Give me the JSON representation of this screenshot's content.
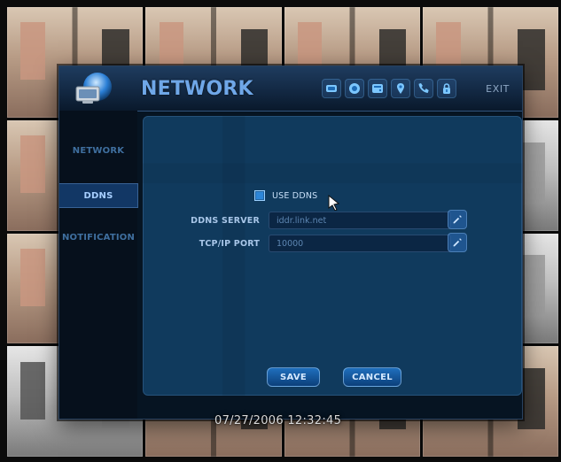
{
  "window": {
    "title": "NETWORK",
    "exit_label": "EXIT"
  },
  "sidebar": {
    "items": [
      {
        "label": "NETWORK",
        "active": false
      },
      {
        "label": "DDNS",
        "active": true
      },
      {
        "label": "NOTIFICATION",
        "active": false
      }
    ]
  },
  "ddns": {
    "use_ddns_label": "USE DDNS",
    "use_ddns_checked": true,
    "server_label": "DDNS SERVER",
    "server_value": "iddr.link.net",
    "port_label": "TCP/IP PORT",
    "port_value": "10000"
  },
  "buttons": {
    "save": "SAVE",
    "cancel": "CANCEL"
  },
  "overlay": {
    "timestamp": "07/27/2006 12:32:45"
  },
  "icons": {
    "toolbar": [
      "network-card-icon",
      "record-icon",
      "hdd-icon",
      "pin-icon",
      "phone-icon",
      "lock-icon"
    ]
  }
}
